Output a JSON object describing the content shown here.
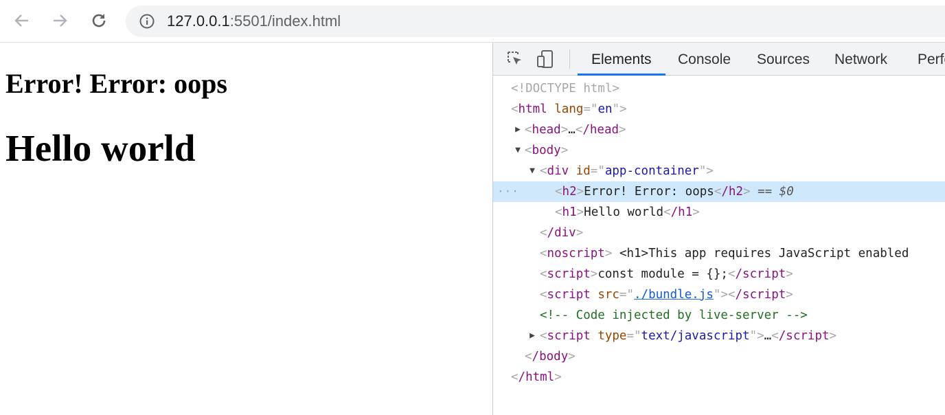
{
  "browser": {
    "url_host": "127.0.0.1",
    "url_path": ":5501/index.html"
  },
  "page": {
    "h2_text": "Error! Error: oops",
    "h1_text": "Hello world"
  },
  "devtools": {
    "tabs": [
      "Elements",
      "Console",
      "Sources",
      "Network",
      "Perfo"
    ],
    "active_tab": "Elements",
    "tree": {
      "doctype": "<!DOCTYPE html>",
      "html_open": {
        "tag": "html",
        "attr": "lang",
        "val": "en"
      },
      "head": {
        "open": "head",
        "ellipsis": "…",
        "close": "/head"
      },
      "body_open": "body",
      "div_open": {
        "tag": "div",
        "attr": "id",
        "val": "app-container"
      },
      "h2_line": {
        "tag": "h2",
        "text": "Error! Error: oops",
        "close": "/h2",
        "marker": "== $0",
        "dots": "···"
      },
      "h1_line": {
        "tag": "h1",
        "text": "Hello world",
        "close": "/h1"
      },
      "div_close": "/div",
      "noscript_line": {
        "tag": "noscript",
        "text": "<h1>This app requires JavaScript enabled"
      },
      "script1": {
        "tag": "script",
        "text": "const module = {};",
        "close": "/script"
      },
      "script2": {
        "tag": "script",
        "attr": "src",
        "val": "./bundle.js",
        "close": "/script"
      },
      "comment": "<!-- Code injected by live-server -->",
      "script3": {
        "tag": "script",
        "attr": "type",
        "val": "text/javascript",
        "ellipsis": "…",
        "close": "/script"
      },
      "body_close": "/body",
      "html_close": "/html"
    }
  },
  "colors": {
    "selected_row": "#cfe8fc",
    "tag": "#881280",
    "attr": "#994500",
    "value": "#1a1aa6",
    "comment": "#236e25",
    "active_tab_underline": "#1a73e8"
  }
}
